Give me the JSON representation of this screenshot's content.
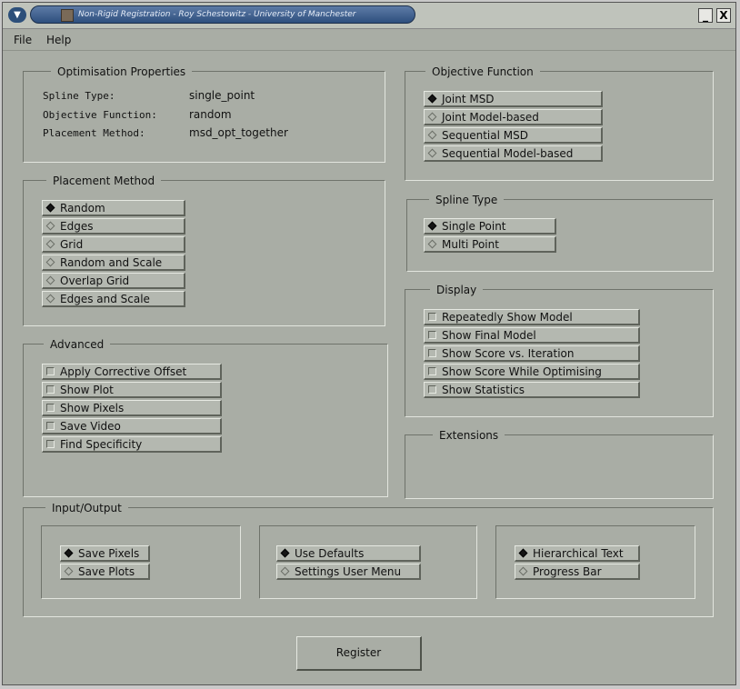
{
  "window": {
    "title": "Non-Rigid Registration - Roy Schestowitz - University of Manchester",
    "minimize": "_",
    "close": "X"
  },
  "menu": [
    "File",
    "Help"
  ],
  "optimisation": {
    "title": "Optimisation Properties",
    "rows": [
      {
        "label": "Spline Type:",
        "value": "single_point"
      },
      {
        "label": "Objective Function:",
        "value": "random"
      },
      {
        "label": "Placement Method:",
        "value": "msd_opt_together"
      }
    ]
  },
  "objective": {
    "title": "Objective Function",
    "options": [
      "Joint MSD",
      "Joint Model-based",
      "Sequential MSD",
      "Sequential Model-based"
    ],
    "selected": 0
  },
  "placement": {
    "title": "Placement Method",
    "options": [
      "Random",
      "Edges",
      "Grid",
      "Random and Scale",
      "Overlap Grid",
      "Edges and Scale"
    ],
    "selected": 0
  },
  "spline": {
    "title": "Spline Type",
    "options": [
      "Single Point",
      "Multi Point"
    ],
    "selected": 0
  },
  "display": {
    "title": "Display",
    "options": [
      "Repeatedly Show Model",
      "Show Final Model",
      "Show Score vs. Iteration",
      "Show Score While Optimising",
      "Show Statistics"
    ]
  },
  "advanced": {
    "title": "Advanced",
    "options": [
      "Apply Corrective Offset",
      "Show Plot",
      "Show Pixels",
      "Save Video",
      "Find Specificity"
    ]
  },
  "extensions": {
    "title": "Extensions"
  },
  "io": {
    "title": "Input/Output",
    "groups": [
      {
        "options": [
          "Save Pixels",
          "Save Plots"
        ],
        "selected": 0
      },
      {
        "options": [
          "Use Defaults",
          "Settings User Menu"
        ],
        "selected": 0
      },
      {
        "options": [
          "Hierarchical Text",
          "Progress Bar"
        ],
        "selected": 0
      }
    ]
  },
  "register_label": "Register"
}
